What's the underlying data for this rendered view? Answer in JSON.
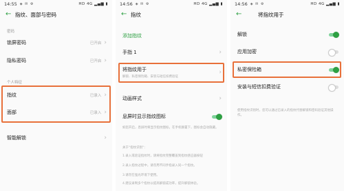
{
  "screens": [
    {
      "status": {
        "time": "14:55",
        "right": "HD 4G ▂▄▆ ▮"
      },
      "title": "指纹、面部与密码",
      "section_password": "密码",
      "rows_password": [
        {
          "label": "锁屏密码",
          "value": "已开启"
        },
        {
          "label": "隐私密码",
          "value": "已开启"
        }
      ],
      "section_biometric": "个人特征",
      "rows_biometric": [
        {
          "label": "指纹",
          "value": "已录入"
        },
        {
          "label": "面部",
          "value": "已录入"
        }
      ],
      "smart_unlock": "智能解锁"
    },
    {
      "status": {
        "time": "14:56",
        "right": "HD 4G ▂▄▆ ▮"
      },
      "title": "指纹",
      "add_fingerprint": "添加指纹",
      "finger1": "手指 1",
      "use_for": "将指纹用于",
      "use_for_sub": "解锁、私密保险箱、安装与短信扣费验证",
      "animation": "动画样式",
      "screen_off_icon": "息屏时显示指纹图标",
      "screen_off_note": "如您开启，息屏时将显示指纹图标，在手机静置下，图标会自动隐藏。",
      "about_title": "关于\"指纹识别\"：",
      "about_lines": [
        "1.录入或验证指纹时，请将指纹完整覆盖到指纹感应器按钮",
        "2.录入指纹过程中，请勿用不同手指录入同一个指纹。",
        "3.请勿在强光环境下使用。",
        "4.建议录制多个指纹以提高解锁成功率，提升解锁体验。"
      ]
    },
    {
      "status": {
        "time": "14:56",
        "right": "HD 4G ▂▄▆ ▮"
      },
      "title": "将指纹用于",
      "rows": [
        {
          "label": "解锁",
          "on": true
        },
        {
          "label": "应用加密",
          "on": false
        },
        {
          "label": "私密保险箱",
          "on": true
        },
        {
          "label": "安装与短信扣费验证",
          "on": false
        }
      ],
      "note": "使用指纹识别时，您可以通过已录入的指纹代替解锁和密码验证其他操作。"
    }
  ],
  "colors": {
    "accent": "#2ea043",
    "highlight": "#e8703a"
  }
}
